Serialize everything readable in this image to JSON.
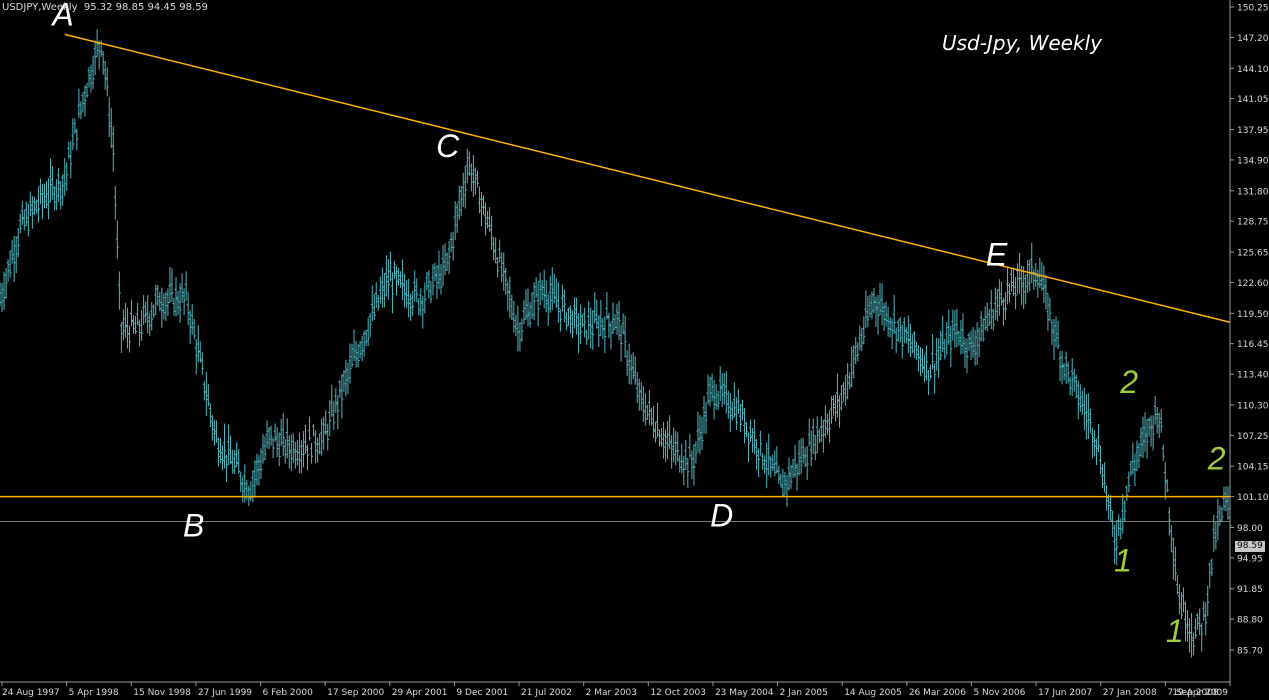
{
  "header": {
    "symbol_info": "USDJPY,Weekly",
    "ohlc": "95.32 98.85 94.45 98.59"
  },
  "current_price": "98.59",
  "chart_data": {
    "type": "ohlc-bar",
    "title": "Usd-Jpy, Weekly",
    "ylim": [
      85.7,
      150.25
    ],
    "xlim": [
      "1997-08-24",
      "2009-04-19"
    ],
    "y_ticks": [
      "150.25",
      "147.20",
      "144.10",
      "141.05",
      "137.95",
      "134.90",
      "131.80",
      "128.75",
      "125.65",
      "122.60",
      "119.50",
      "116.45",
      "113.40",
      "110.30",
      "107.25",
      "104.15",
      "101.10",
      "98.00",
      "94.95",
      "91.85",
      "88.80",
      "85.70"
    ],
    "x_tick_labels": [
      "24 Aug 1997",
      "5 Apr 1998",
      "15 Nov 1998",
      "27 Jun 1999",
      "6 Feb 2000",
      "17 Sep 2000",
      "29 Apr 2001",
      "9 Dec 2001",
      "21 Jul 2002",
      "2 Mar 2003",
      "12 Oct 2003",
      "23 May 2004",
      "2 Jan 2005",
      "14 Aug 2005",
      "26 Mar 2006",
      "5 Nov 2006",
      "17 Jun 2007",
      "27 Jan 2008",
      "7 Sep 2008",
      "19 Apr 2009"
    ],
    "price_path": [
      [
        "1997-08-24",
        121.0
      ],
      [
        "1997-11-01",
        128.0
      ],
      [
        "1998-01-15",
        131.0
      ],
      [
        "1998-04-05",
        133.0
      ],
      [
        "1998-06-15",
        142.0
      ],
      [
        "1998-08-10",
        147.2
      ],
      [
        "1998-09-20",
        136.0
      ],
      [
        "1998-10-15",
        118.0
      ],
      [
        "1998-12-15",
        118.0
      ],
      [
        "1999-03-01",
        121.0
      ],
      [
        "1999-06-01",
        121.0
      ],
      [
        "1999-09-10",
        107.0
      ],
      [
        "2000-01-05",
        102.0
      ],
      [
        "2000-03-15",
        107.0
      ],
      [
        "2000-06-01",
        106.0
      ],
      [
        "2000-09-17",
        107.0
      ],
      [
        "2001-01-15",
        116.0
      ],
      [
        "2001-04-29",
        123.0
      ],
      [
        "2001-08-15",
        121.0
      ],
      [
        "2001-11-15",
        124.0
      ],
      [
        "2002-01-31",
        134.7
      ],
      [
        "2002-04-15",
        128.0
      ],
      [
        "2002-07-21",
        118.0
      ],
      [
        "2002-10-15",
        122.0
      ],
      [
        "2003-03-02",
        118.0
      ],
      [
        "2003-07-01",
        119.0
      ],
      [
        "2003-09-15",
        111.0
      ],
      [
        "2004-01-01",
        106.0
      ],
      [
        "2004-03-15",
        104.5
      ],
      [
        "2004-05-23",
        112.0
      ],
      [
        "2004-08-15",
        110.0
      ],
      [
        "2005-01-02",
        103.0
      ],
      [
        "2005-01-17",
        102.0
      ],
      [
        "2005-05-15",
        107.0
      ],
      [
        "2005-08-14",
        111.0
      ],
      [
        "2005-12-05",
        121.0
      ],
      [
        "2006-03-26",
        117.0
      ],
      [
        "2006-06-15",
        114.0
      ],
      [
        "2006-09-15",
        118.0
      ],
      [
        "2006-11-05",
        116.0
      ],
      [
        "2007-02-15",
        121.0
      ],
      [
        "2007-06-22",
        124.0
      ],
      [
        "2007-09-15",
        115.0
      ],
      [
        "2008-01-15",
        107.0
      ],
      [
        "2008-03-17",
        96.5
      ],
      [
        "2008-05-15",
        104.0
      ],
      [
        "2008-08-15",
        110.0
      ],
      [
        "2008-10-24",
        91.0
      ],
      [
        "2008-12-17",
        87.1
      ],
      [
        "2009-01-21",
        89.0
      ],
      [
        "2009-02-25",
        97.0
      ],
      [
        "2009-04-05",
        100.5
      ],
      [
        "2009-04-19",
        98.59
      ]
    ],
    "trendlines": [
      {
        "kind": "descending-resistance",
        "from": [
          "1998-04-05",
          147.5
        ],
        "to": [
          "2009-04-19",
          118.6
        ],
        "color": "#ffb300"
      },
      {
        "kind": "horizontal-support",
        "y": 101.1,
        "color": "#ffb300"
      },
      {
        "kind": "current-price",
        "y": 98.59,
        "color": "#9a9a9a"
      }
    ],
    "annotations": [
      {
        "text": "A",
        "x": "1998-03-30",
        "y": 148.4,
        "color": "#ffffff"
      },
      {
        "text": "B",
        "x": "1999-06-25",
        "y": 97.1,
        "color": "#ffffff"
      },
      {
        "text": "C",
        "x": "2001-11-20",
        "y": 135.2,
        "color": "#ffffff"
      },
      {
        "text": "D",
        "x": "2004-06-25",
        "y": 98.1,
        "color": "#ffffff"
      },
      {
        "text": "E",
        "x": "2007-02-01",
        "y": 124.3,
        "color": "#ffffff"
      },
      {
        "text": "1",
        "x": "2008-04-14",
        "y": 93.6,
        "color": "#9dcc3a"
      },
      {
        "text": "2",
        "x": "2008-05-05",
        "y": 111.5,
        "color": "#9dcc3a"
      },
      {
        "text": "1",
        "x": "2008-10-10",
        "y": 86.5,
        "color": "#9dcc3a"
      },
      {
        "text": "2",
        "x": "2009-03-04",
        "y": 103.8,
        "color": "#9dcc3a"
      }
    ],
    "colors": {
      "bars": "#4fb8c0",
      "axis": "#9a9a9a",
      "grid": "none"
    },
    "grid": false,
    "legend": "none"
  }
}
